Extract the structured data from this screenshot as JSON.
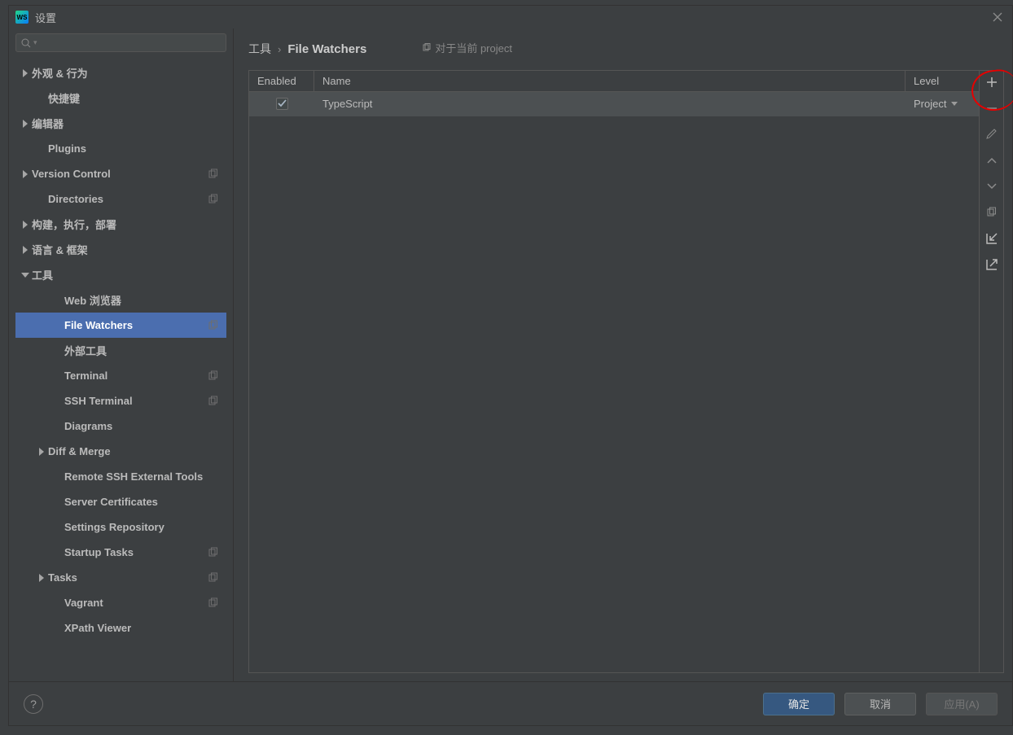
{
  "window": {
    "title": "设置"
  },
  "search": {
    "placeholder": ""
  },
  "sidebar": {
    "items": [
      {
        "label": "外观 & 行为",
        "depth": 1,
        "arrow": "right",
        "copy": false
      },
      {
        "label": "快捷键",
        "depth": 2,
        "arrow": "",
        "copy": false
      },
      {
        "label": "编辑器",
        "depth": 1,
        "arrow": "right",
        "copy": false
      },
      {
        "label": "Plugins",
        "depth": 2,
        "arrow": "",
        "copy": false
      },
      {
        "label": "Version Control",
        "depth": 1,
        "arrow": "right",
        "copy": true
      },
      {
        "label": "Directories",
        "depth": 2,
        "arrow": "",
        "copy": true
      },
      {
        "label": "构建，执行，部署",
        "depth": 1,
        "arrow": "right",
        "copy": false
      },
      {
        "label": "语言 & 框架",
        "depth": 1,
        "arrow": "right",
        "copy": false
      },
      {
        "label": "工具",
        "depth": 1,
        "arrow": "down",
        "copy": false
      },
      {
        "label": "Web 浏览器",
        "depth": 3,
        "arrow": "",
        "copy": false
      },
      {
        "label": "File Watchers",
        "depth": 3,
        "arrow": "",
        "copy": true,
        "selected": true
      },
      {
        "label": "外部工具",
        "depth": 3,
        "arrow": "",
        "copy": false
      },
      {
        "label": "Terminal",
        "depth": 3,
        "arrow": "",
        "copy": true
      },
      {
        "label": "SSH Terminal",
        "depth": 3,
        "arrow": "",
        "copy": true
      },
      {
        "label": "Diagrams",
        "depth": 3,
        "arrow": "",
        "copy": false
      },
      {
        "label": "Diff & Merge",
        "depth": 2,
        "arrow": "right",
        "copy": false
      },
      {
        "label": "Remote SSH External Tools",
        "depth": 3,
        "arrow": "",
        "copy": false
      },
      {
        "label": "Server Certificates",
        "depth": 3,
        "arrow": "",
        "copy": false
      },
      {
        "label": "Settings Repository",
        "depth": 3,
        "arrow": "",
        "copy": false
      },
      {
        "label": "Startup Tasks",
        "depth": 3,
        "arrow": "",
        "copy": true
      },
      {
        "label": "Tasks",
        "depth": 2,
        "arrow": "right",
        "copy": true
      },
      {
        "label": "Vagrant",
        "depth": 3,
        "arrow": "",
        "copy": true
      },
      {
        "label": "XPath Viewer",
        "depth": 3,
        "arrow": "",
        "copy": false
      }
    ]
  },
  "breadcrumb": {
    "crumb1": "工具",
    "crumb2": "File Watchers",
    "scope_label": "对于当前 project"
  },
  "table": {
    "headers": {
      "enabled": "Enabled",
      "name": "Name",
      "level": "Level"
    },
    "rows": [
      {
        "enabled": true,
        "name": "TypeScript",
        "level": "Project"
      }
    ]
  },
  "footer": {
    "ok": "确定",
    "cancel": "取消",
    "apply": "应用(A)"
  }
}
